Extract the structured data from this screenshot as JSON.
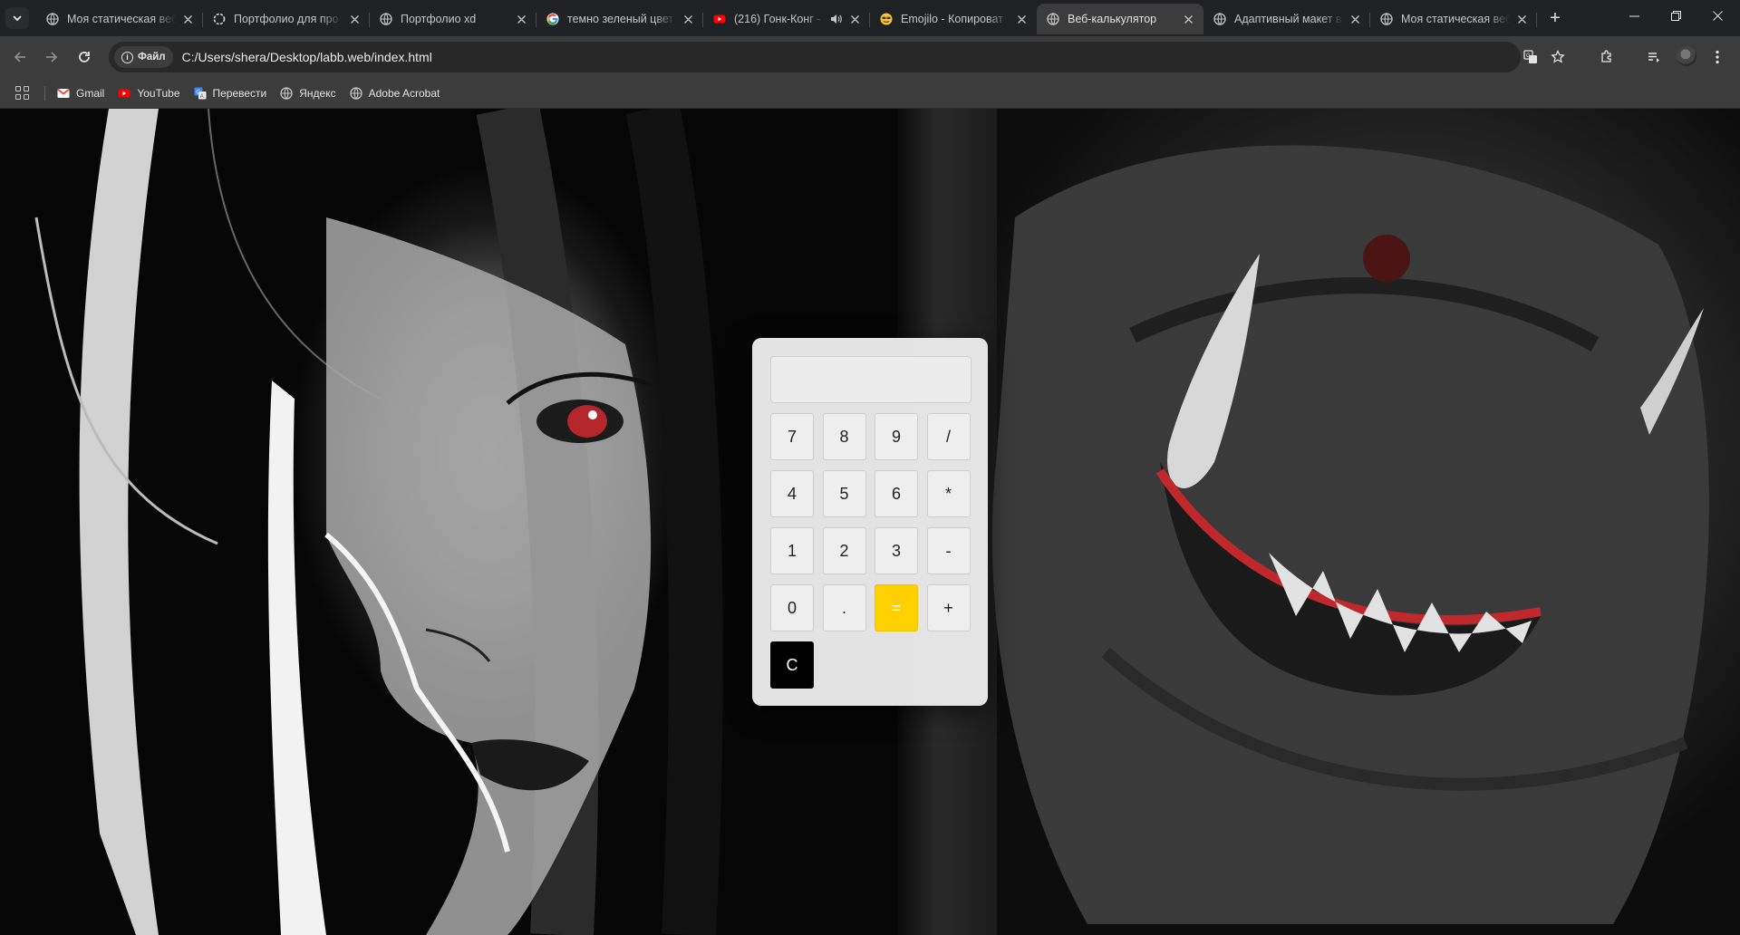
{
  "browser": {
    "tabs": [
      {
        "title": "Моя статическая веб",
        "favicon": "globe-icon",
        "active": false
      },
      {
        "title": "Портфолио для про",
        "favicon": "openai-icon",
        "active": false
      },
      {
        "title": "Портфолио xd",
        "favicon": "globe-icon",
        "active": false
      },
      {
        "title": "темно зеленый цвет",
        "favicon": "google-icon",
        "active": false
      },
      {
        "title": "(216) Гонк-Конг -",
        "favicon": "youtube-icon",
        "active": false,
        "audio": true
      },
      {
        "title": "Emojilo - Копироват",
        "favicon": "emoji-icon",
        "active": false
      },
      {
        "title": "Веб-калькулятор",
        "favicon": "globe-icon",
        "active": true
      },
      {
        "title": "Адаптивный макет в",
        "favicon": "globe-icon",
        "active": false
      },
      {
        "title": "Моя статическая веб",
        "favicon": "globe-icon",
        "active": false
      }
    ],
    "address": {
      "chip_label": "Файл",
      "url": "C:/Users/shera/Desktop/labb.web/index.html"
    },
    "bookmarks": [
      {
        "label": "Gmail",
        "icon": "gmail-icon"
      },
      {
        "label": "YouTube",
        "icon": "youtube-icon"
      },
      {
        "label": "Перевести",
        "icon": "translate-icon"
      },
      {
        "label": "Яндекс",
        "icon": "globe-icon"
      },
      {
        "label": "Adobe Acrobat",
        "icon": "globe-icon"
      }
    ]
  },
  "calculator": {
    "display_value": "",
    "keys": [
      "7",
      "8",
      "9",
      "/",
      "4",
      "5",
      "6",
      "*",
      "1",
      "2",
      "3",
      "-",
      "0",
      ".",
      "=",
      "+",
      "C"
    ],
    "colors": {
      "equals": "#ffd000",
      "clear": "#000000",
      "panel": "#ececec"
    }
  }
}
